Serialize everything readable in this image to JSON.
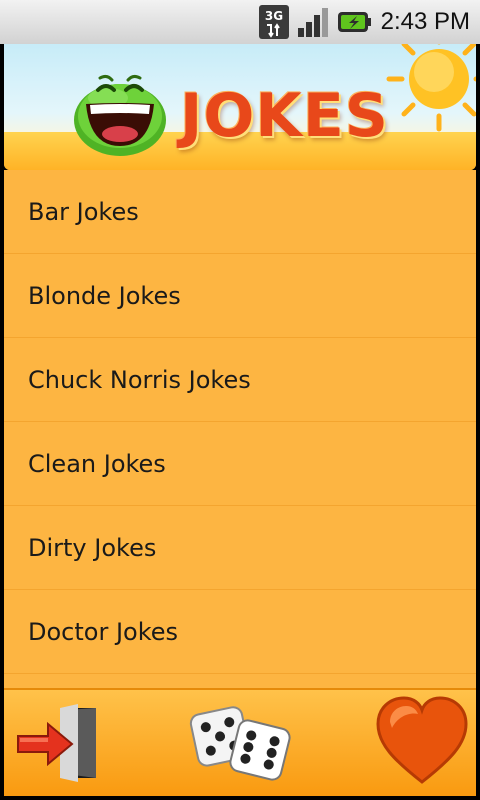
{
  "status_bar": {
    "network_label": "3G",
    "time": "2:43 PM"
  },
  "header": {
    "logo_text": "JOKES"
  },
  "categories": [
    {
      "label": "Bar Jokes"
    },
    {
      "label": "Blonde Jokes"
    },
    {
      "label": "Chuck Norris Jokes"
    },
    {
      "label": "Clean Jokes"
    },
    {
      "label": "Dirty Jokes"
    },
    {
      "label": "Doctor Jokes"
    }
  ],
  "toolbar": {
    "icons": [
      "exit-icon",
      "dice-icon",
      "heart-icon"
    ]
  },
  "colors": {
    "list_background": "#fdb542",
    "divider": "#f4a52f",
    "logo_text": "#e8481a",
    "mascot_green": "#5cc52b",
    "heart": "#ef5a10"
  }
}
